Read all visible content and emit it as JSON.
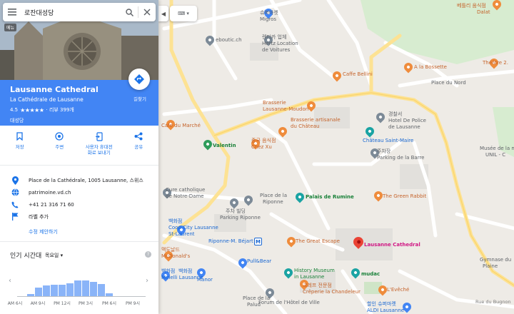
{
  "search": {
    "query": "로잔대성당",
    "menu_tooltip": "메뉴"
  },
  "place": {
    "name": "Lausanne Cathedral",
    "alt_name": "La Cathédrale de Lausanne",
    "rating": "4.5",
    "stars": "★★★★★",
    "reviews": "· 리뷰 399개",
    "category": "대성당",
    "directions_label": "길찾기"
  },
  "actions": [
    {
      "label": "저장",
      "icon": "bookmark-icon"
    },
    {
      "label": "주변",
      "icon": "nearby-icon"
    },
    {
      "label": "사용자 휴대전화로 보내기",
      "icon": "send-to-phone-icon"
    },
    {
      "label": "공유",
      "icon": "share-icon"
    }
  ],
  "details": {
    "address": "Place de la Cathédrale, 1005 Lausanne, 스위스",
    "website": "patrimoine.vd.ch",
    "phone": "+41 21 316 71 60",
    "add_label": "라벨 추가",
    "suggest_edit": "수정 제안하기"
  },
  "popular_times": {
    "heading": "인기 시간대",
    "day": "목요일",
    "ticks": [
      "AM 6시",
      "AM 9시",
      "PM 12시",
      "PM 3시",
      "PM 6시",
      "PM 9시"
    ]
  },
  "chart_data": {
    "type": "bar",
    "title": "인기 시간대",
    "categories": [
      "AM 8시",
      "AM 9시",
      "AM 10시",
      "AM 11시",
      "PM 12시",
      "PM 1시",
      "PM 2시",
      "PM 3시",
      "PM 4시",
      "PM 5시",
      "PM 6시"
    ],
    "values": [
      8,
      30,
      38,
      40,
      40,
      45,
      55,
      55,
      50,
      42,
      10
    ],
    "ylim": [
      0,
      100
    ]
  },
  "map": {
    "labels": [
      {
        "text": "슈퍼마켓",
        "cls": "poi-blue"
      },
      {
        "text": "Migros",
        "cls": "poi-gray"
      },
      {
        "text": "렌터카 업체",
        "cls": "poi-gray"
      },
      {
        "text": "Hertz Location",
        "cls": "poi-gray"
      },
      {
        "text": "de Voitures",
        "cls": "poi-gray"
      },
      {
        "text": "eboutic.ch",
        "cls": "poi-gray"
      },
      {
        "text": "Caffe Bellini",
        "cls": "poi-orange"
      },
      {
        "text": "A la Bossette",
        "cls": "poi-orange"
      },
      {
        "text": "Brasserie",
        "cls": "poi-orange"
      },
      {
        "text": "Lausanne-Moudon",
        "cls": "poi-orange"
      },
      {
        "text": "Brasserie artisanale",
        "cls": "poi-orange"
      },
      {
        "text": "du Château",
        "cls": "poi-orange"
      },
      {
        "text": "중국 음식점",
        "cls": "poi-orange"
      },
      {
        "text": "Chez Xu",
        "cls": "poi-orange"
      },
      {
        "text": "경찰서",
        "cls": "poi-gray"
      },
      {
        "text": "Hotel De Police",
        "cls": "poi-gray"
      },
      {
        "text": "de Lausanne",
        "cls": "poi-gray"
      },
      {
        "text": "Château Saint-Maire",
        "cls": "poi-blue"
      },
      {
        "text": "주차장",
        "cls": "poi-gray"
      },
      {
        "text": "Parking de la Barre",
        "cls": "poi-gray"
      },
      {
        "text": "Café du Marché",
        "cls": "poi-orange"
      },
      {
        "text": "Valentin",
        "cls": "poi-green bold"
      },
      {
        "text": "Cure catholique",
        "cls": "poi-gray"
      },
      {
        "text": "de Notre-Dame",
        "cls": "poi-gray"
      },
      {
        "text": "Place de la",
        "cls": "poi-gray"
      },
      {
        "text": "Riponne",
        "cls": "poi-gray"
      },
      {
        "text": "Palais de Rumine",
        "cls": "poi-green bold"
      },
      {
        "text": "The Green Rabbit",
        "cls": "poi-orange"
      },
      {
        "text": "주차 빌딩",
        "cls": "poi-gray"
      },
      {
        "text": "Parking Riponne",
        "cls": "poi-gray"
      },
      {
        "text": "백화점",
        "cls": "poi-blue"
      },
      {
        "text": "Coop City Lausanne",
        "cls": "poi-blue"
      },
      {
        "text": "St-Laurent",
        "cls": "poi-blue"
      },
      {
        "text": "Riponne-M. Béjart",
        "cls": "poi-blue"
      },
      {
        "text": "The Great Escape",
        "cls": "poi-orange"
      },
      {
        "text": "Lausanne Cathedral",
        "cls": "poi-pink bold"
      },
      {
        "text": "맥도날드",
        "cls": "poi-orange"
      },
      {
        "text": "McDonald's",
        "cls": "poi-orange"
      },
      {
        "text": "Pull&Bear",
        "cls": "poi-blue"
      },
      {
        "text": "History Museum",
        "cls": "poi-green"
      },
      {
        "text": "in Lausanne",
        "cls": "poi-green"
      },
      {
        "text": "mudac",
        "cls": "poi-green bold"
      },
      {
        "text": "백화점",
        "cls": "poi-blue"
      },
      {
        "text": "Minelli Lausanne",
        "cls": "poi-blue"
      },
      {
        "text": "백화점",
        "cls": "poi-blue"
      },
      {
        "text": "Manor",
        "cls": "poi-blue"
      },
      {
        "text": "크레프 전문점",
        "cls": "poi-orange"
      },
      {
        "text": "Crêperie la Chandeleur",
        "cls": "poi-orange"
      },
      {
        "text": "L'Evêché",
        "cls": "poi-orange"
      },
      {
        "text": "Place de la",
        "cls": "poi-gray"
      },
      {
        "text": "Palud",
        "cls": "poi-gray"
      },
      {
        "text": "Forum de l'Hôtel de Ville",
        "cls": "poi-gray"
      },
      {
        "text": "할인 슈퍼마켓",
        "cls": "poi-blue"
      },
      {
        "text": "ALDI Lausanne",
        "cls": "poi-blue"
      },
      {
        "text": "Place du Nord",
        "cls": "poi-gray"
      },
      {
        "text": "Théâtre 2.",
        "cls": "poi-orange"
      },
      {
        "text": "Musée de la m",
        "cls": "poi-gray"
      },
      {
        "text": "UNIL - C",
        "cls": "poi-gray"
      },
      {
        "text": "베틀리 움식점",
        "cls": "poi-orange"
      },
      {
        "text": "Dalat",
        "cls": "poi-orange"
      },
      {
        "text": "Gymnase du",
        "cls": "poi-gray"
      },
      {
        "text": "Plaine",
        "cls": "poi-gray"
      },
      {
        "text": "Rue du Bugnon",
        "cls": "poi-gray"
      }
    ]
  }
}
